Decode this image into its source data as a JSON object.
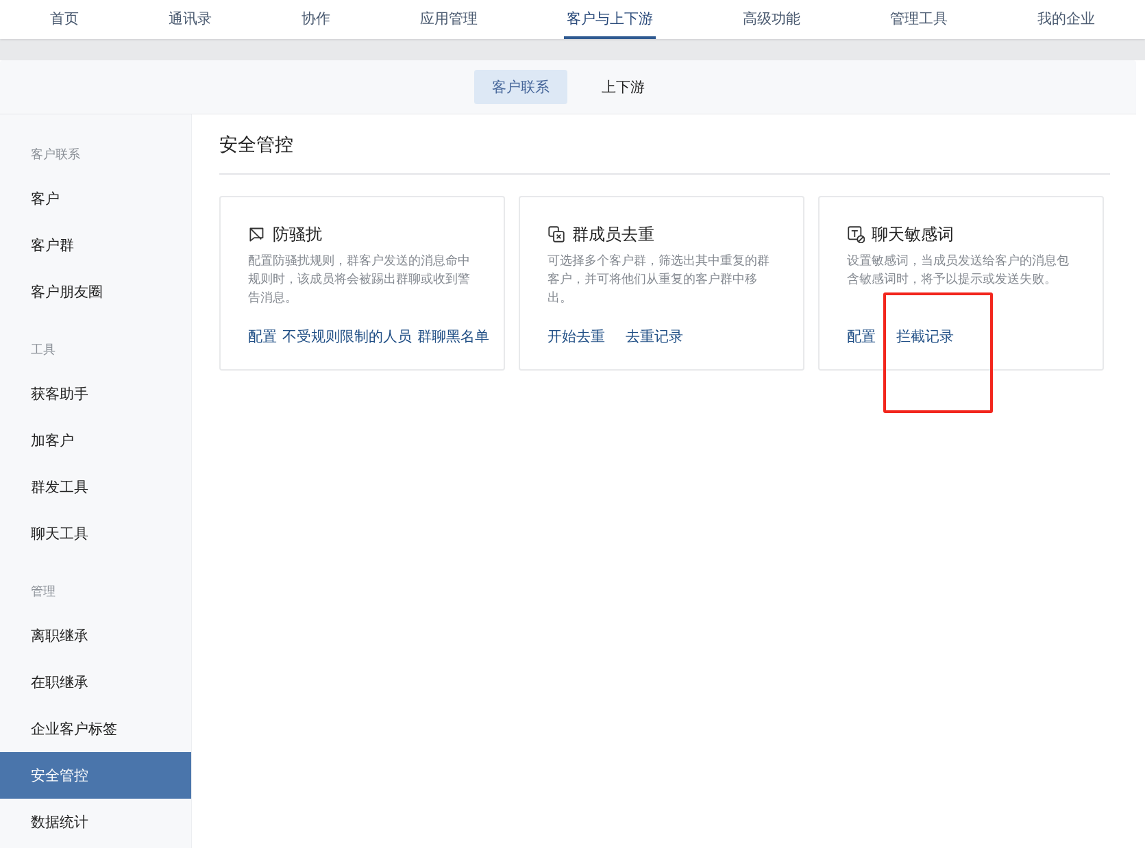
{
  "top_nav": [
    {
      "label": "首页",
      "selected": false
    },
    {
      "label": "通讯录",
      "selected": false
    },
    {
      "label": "协作",
      "selected": false
    },
    {
      "label": "应用管理",
      "selected": false
    },
    {
      "label": "客户与上下游",
      "selected": true
    },
    {
      "label": "高级功能",
      "selected": false
    },
    {
      "label": "管理工具",
      "selected": false
    },
    {
      "label": "我的企业",
      "selected": false
    }
  ],
  "sub_tabs": [
    {
      "label": "客户联系",
      "selected": true
    },
    {
      "label": "上下游",
      "selected": false
    }
  ],
  "sidebar": {
    "groups": [
      {
        "heading": "客户联系",
        "items": [
          {
            "label": "客户",
            "selected": false
          },
          {
            "label": "客户群",
            "selected": false
          },
          {
            "label": "客户朋友圈",
            "selected": false
          }
        ]
      },
      {
        "heading": "工具",
        "items": [
          {
            "label": "获客助手",
            "selected": false
          },
          {
            "label": "加客户",
            "selected": false
          },
          {
            "label": "群发工具",
            "selected": false
          },
          {
            "label": "聊天工具",
            "selected": false
          }
        ]
      },
      {
        "heading": "管理",
        "items": [
          {
            "label": "离职继承",
            "selected": false
          },
          {
            "label": "在职继承",
            "selected": false
          },
          {
            "label": "企业客户标签",
            "selected": false
          },
          {
            "label": "安全管控",
            "selected": true
          },
          {
            "label": "数据统计",
            "selected": false
          }
        ]
      }
    ]
  },
  "page_title": "安全管控",
  "cards": [
    {
      "title": "防骚扰",
      "description": "配置防骚扰规则，群客户发送的消息命中规则时，该成员将会被踢出群聊或收到警告消息。",
      "links": [
        {
          "label": "配置",
          "kind": "plain"
        },
        {
          "label": "不受规则限制的人员",
          "kind": "plain"
        },
        {
          "label": "群聊黑名单",
          "kind": "plain"
        }
      ]
    },
    {
      "title": "群成员去重",
      "description": "可选择多个客户群，筛选出其中重复的群客户，并可将他们从重复的客户群中移出。",
      "links": [
        {
          "label": "开始去重",
          "kind": "plain"
        },
        {
          "label": "去重记录",
          "kind": "plain"
        }
      ]
    },
    {
      "title": "聊天敏感词",
      "description": "设置敏感词，当成员发送给客户的消息包含敏感词时，将予以提示或发送失败。",
      "links": [
        {
          "label": "配置",
          "kind": "plain"
        },
        {
          "label": "拦截记录",
          "kind": "boxed"
        }
      ]
    }
  ]
}
